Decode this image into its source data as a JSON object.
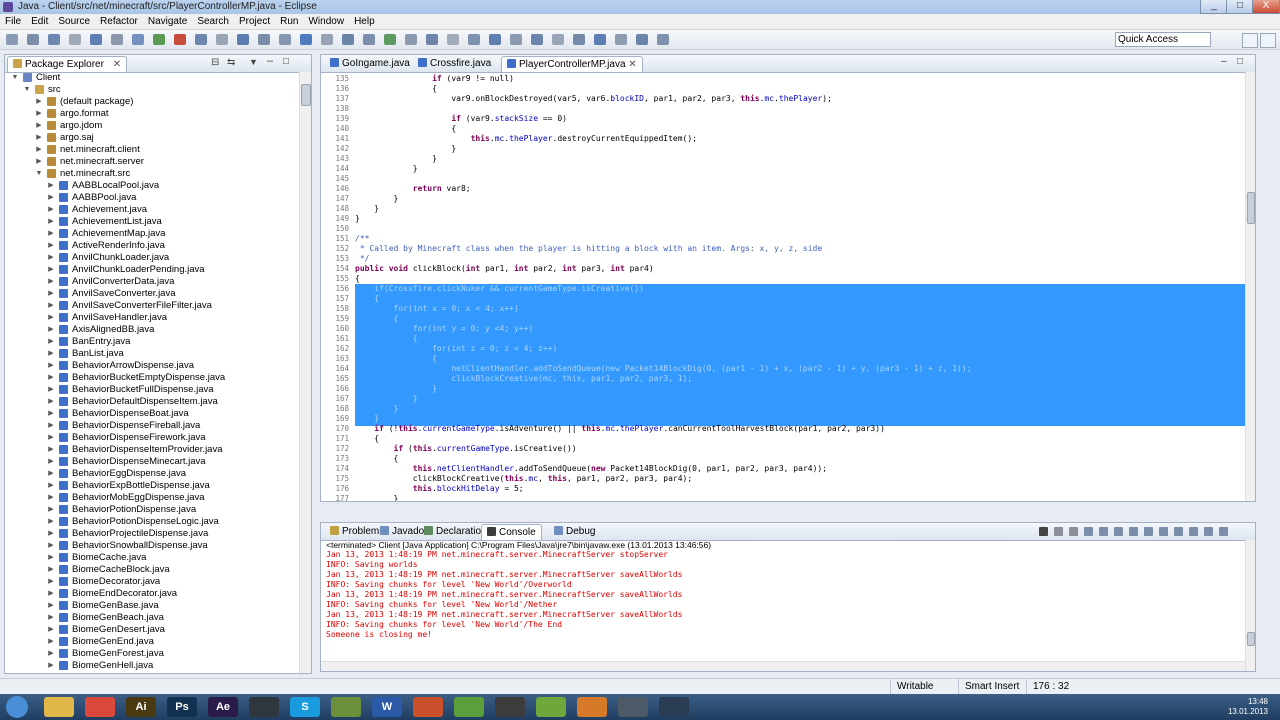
{
  "window": {
    "title": "Java - Client/src/net/minecraft/src/PlayerControllerMP.java - Eclipse",
    "min": "_",
    "max": "□",
    "close": "X"
  },
  "menu": [
    "File",
    "Edit",
    "Source",
    "Refactor",
    "Navigate",
    "Search",
    "Project",
    "Run",
    "Window",
    "Help"
  ],
  "toolbar": {
    "quick_access": "Quick Access"
  },
  "package_explorer": {
    "title": "Package Explorer",
    "items": [
      {
        "label": "Client",
        "depth": 0,
        "arrow": "▼",
        "icon": "#6a84c6"
      },
      {
        "label": "src",
        "depth": 1,
        "arrow": "▼",
        "icon": "#c9a347"
      },
      {
        "label": "(default package)",
        "depth": 2,
        "arrow": "▶",
        "icon": "#b88a3a"
      },
      {
        "label": "argo.format",
        "depth": 2,
        "arrow": "▶",
        "icon": "#b88a3a"
      },
      {
        "label": "argo.jdom",
        "depth": 2,
        "arrow": "▶",
        "icon": "#b88a3a"
      },
      {
        "label": "argo.saj",
        "depth": 2,
        "arrow": "▶",
        "icon": "#b88a3a"
      },
      {
        "label": "net.minecraft.client",
        "depth": 2,
        "arrow": "▶",
        "icon": "#b88a3a"
      },
      {
        "label": "net.minecraft.server",
        "depth": 2,
        "arrow": "▶",
        "icon": "#b88a3a"
      },
      {
        "label": "net.minecraft.src",
        "depth": 2,
        "arrow": "▼",
        "icon": "#b88a3a"
      },
      {
        "label": "AABBLocalPool.java",
        "depth": 3,
        "arrow": "▶",
        "icon": "#3f6fc9"
      },
      {
        "label": "AABBPool.java",
        "depth": 3,
        "arrow": "▶",
        "icon": "#3f6fc9"
      },
      {
        "label": "Achievement.java",
        "depth": 3,
        "arrow": "▶",
        "icon": "#3f6fc9"
      },
      {
        "label": "AchievementList.java",
        "depth": 3,
        "arrow": "▶",
        "icon": "#3f6fc9"
      },
      {
        "label": "AchievementMap.java",
        "depth": 3,
        "arrow": "▶",
        "icon": "#3f6fc9"
      },
      {
        "label": "ActiveRenderInfo.java",
        "depth": 3,
        "arrow": "▶",
        "icon": "#3f6fc9"
      },
      {
        "label": "AnvilChunkLoader.java",
        "depth": 3,
        "arrow": "▶",
        "icon": "#3f6fc9"
      },
      {
        "label": "AnvilChunkLoaderPending.java",
        "depth": 3,
        "arrow": "▶",
        "icon": "#3f6fc9"
      },
      {
        "label": "AnvilConverterData.java",
        "depth": 3,
        "arrow": "▶",
        "icon": "#3f6fc9"
      },
      {
        "label": "AnvilSaveConverter.java",
        "depth": 3,
        "arrow": "▶",
        "icon": "#3f6fc9"
      },
      {
        "label": "AnvilSaveConverterFileFilter.java",
        "depth": 3,
        "arrow": "▶",
        "icon": "#3f6fc9"
      },
      {
        "label": "AnvilSaveHandler.java",
        "depth": 3,
        "arrow": "▶",
        "icon": "#3f6fc9"
      },
      {
        "label": "AxisAlignedBB.java",
        "depth": 3,
        "arrow": "▶",
        "icon": "#3f6fc9"
      },
      {
        "label": "BanEntry.java",
        "depth": 3,
        "arrow": "▶",
        "icon": "#3f6fc9"
      },
      {
        "label": "BanList.java",
        "depth": 3,
        "arrow": "▶",
        "icon": "#3f6fc9"
      },
      {
        "label": "BehaviorArrowDispense.java",
        "depth": 3,
        "arrow": "▶",
        "icon": "#3f6fc9"
      },
      {
        "label": "BehaviorBucketEmptyDispense.java",
        "depth": 3,
        "arrow": "▶",
        "icon": "#3f6fc9"
      },
      {
        "label": "BehaviorBucketFullDispense.java",
        "depth": 3,
        "arrow": "▶",
        "icon": "#3f6fc9"
      },
      {
        "label": "BehaviorDefaultDispenseItem.java",
        "depth": 3,
        "arrow": "▶",
        "icon": "#3f6fc9"
      },
      {
        "label": "BehaviorDispenseBoat.java",
        "depth": 3,
        "arrow": "▶",
        "icon": "#3f6fc9"
      },
      {
        "label": "BehaviorDispenseFireball.java",
        "depth": 3,
        "arrow": "▶",
        "icon": "#3f6fc9"
      },
      {
        "label": "BehaviorDispenseFirework.java",
        "depth": 3,
        "arrow": "▶",
        "icon": "#3f6fc9"
      },
      {
        "label": "BehaviorDispenseItemProvider.java",
        "depth": 3,
        "arrow": "▶",
        "icon": "#3f6fc9"
      },
      {
        "label": "BehaviorDispenseMinecart.java",
        "depth": 3,
        "arrow": "▶",
        "icon": "#3f6fc9"
      },
      {
        "label": "BehaviorEggDispense.java",
        "depth": 3,
        "arrow": "▶",
        "icon": "#3f6fc9"
      },
      {
        "label": "BehaviorExpBottleDispense.java",
        "depth": 3,
        "arrow": "▶",
        "icon": "#3f6fc9"
      },
      {
        "label": "BehaviorMobEggDispense.java",
        "depth": 3,
        "arrow": "▶",
        "icon": "#3f6fc9"
      },
      {
        "label": "BehaviorPotionDispense.java",
        "depth": 3,
        "arrow": "▶",
        "icon": "#3f6fc9"
      },
      {
        "label": "BehaviorPotionDispenseLogic.java",
        "depth": 3,
        "arrow": "▶",
        "icon": "#3f6fc9"
      },
      {
        "label": "BehaviorProjectileDispense.java",
        "depth": 3,
        "arrow": "▶",
        "icon": "#3f6fc9"
      },
      {
        "label": "BehaviorSnowballDispense.java",
        "depth": 3,
        "arrow": "▶",
        "icon": "#3f6fc9"
      },
      {
        "label": "BiomeCache.java",
        "depth": 3,
        "arrow": "▶",
        "icon": "#3f6fc9"
      },
      {
        "label": "BiomeCacheBlock.java",
        "depth": 3,
        "arrow": "▶",
        "icon": "#3f6fc9"
      },
      {
        "label": "BiomeDecorator.java",
        "depth": 3,
        "arrow": "▶",
        "icon": "#3f6fc9"
      },
      {
        "label": "BiomeEndDecorator.java",
        "depth": 3,
        "arrow": "▶",
        "icon": "#3f6fc9"
      },
      {
        "label": "BiomeGenBase.java",
        "depth": 3,
        "arrow": "▶",
        "icon": "#3f6fc9"
      },
      {
        "label": "BiomeGenBeach.java",
        "depth": 3,
        "arrow": "▶",
        "icon": "#3f6fc9"
      },
      {
        "label": "BiomeGenDesert.java",
        "depth": 3,
        "arrow": "▶",
        "icon": "#3f6fc9"
      },
      {
        "label": "BiomeGenEnd.java",
        "depth": 3,
        "arrow": "▶",
        "icon": "#3f6fc9"
      },
      {
        "label": "BiomeGenForest.java",
        "depth": 3,
        "arrow": "▶",
        "icon": "#3f6fc9"
      },
      {
        "label": "BiomeGenHell.java",
        "depth": 3,
        "arrow": "▶",
        "icon": "#3f6fc9"
      }
    ]
  },
  "editor": {
    "tabs": [
      {
        "label": "GoIngame.java",
        "active": false
      },
      {
        "label": "Crossfire.java",
        "active": false
      },
      {
        "label": "PlayerControllerMP.java",
        "active": true
      }
    ],
    "lines": [
      {
        "n": "135",
        "t": "                if (var9 != null)",
        "sel": false
      },
      {
        "n": "136",
        "t": "                {",
        "sel": false
      },
      {
        "n": "137",
        "t": "                    var9.onBlockDestroyed(var5, var6.blockID, par1, par2, par3, this.mc.thePlayer);",
        "sel": false
      },
      {
        "n": "138",
        "t": "",
        "sel": false
      },
      {
        "n": "139",
        "t": "                    if (var9.stackSize == 0)",
        "sel": false
      },
      {
        "n": "140",
        "t": "                    {",
        "sel": false
      },
      {
        "n": "141",
        "t": "                        this.mc.thePlayer.destroyCurrentEquippedItem();",
        "sel": false
      },
      {
        "n": "142",
        "t": "                    }",
        "sel": false
      },
      {
        "n": "143",
        "t": "                }",
        "sel": false
      },
      {
        "n": "144",
        "t": "            }",
        "sel": false
      },
      {
        "n": "145",
        "t": "",
        "sel": false
      },
      {
        "n": "146",
        "t": "            return var8;",
        "sel": false
      },
      {
        "n": "147",
        "t": "        }",
        "sel": false
      },
      {
        "n": "148",
        "t": "    }",
        "sel": false
      },
      {
        "n": "149",
        "t": "}",
        "sel": false
      },
      {
        "n": "150",
        "t": "",
        "sel": false
      },
      {
        "n": "151",
        "t": "/**",
        "sel": false
      },
      {
        "n": "152",
        "t": " * Called by Minecraft class when the player is hitting a block with an item. Args: x, y, z, side",
        "sel": false
      },
      {
        "n": "153",
        "t": " */",
        "sel": false
      },
      {
        "n": "154",
        "t": "public void clickBlock(int par1, int par2, int par3, int par4)",
        "sel": false
      },
      {
        "n": "155",
        "t": "{",
        "sel": false
      },
      {
        "n": "156",
        "t": "    if(Crossfire.clickNuker && currentGameType.isCreative())",
        "sel": true
      },
      {
        "n": "157",
        "t": "    {",
        "sel": true
      },
      {
        "n": "158",
        "t": "        for(int x = 0; x < 4; x++)",
        "sel": true
      },
      {
        "n": "159",
        "t": "        {",
        "sel": true
      },
      {
        "n": "160",
        "t": "            for(int y = 0; y <4; y++)",
        "sel": true
      },
      {
        "n": "161",
        "t": "            {",
        "sel": true
      },
      {
        "n": "162",
        "t": "                for(int z = 0; z < 4; z++)",
        "sel": true
      },
      {
        "n": "163",
        "t": "                {",
        "sel": true
      },
      {
        "n": "164",
        "t": "                    netClientHandler.addToSendQueue(new Packet14BlockDig(0, (par1 - 1) + x, (par2 - 1) + y, (par3 - 1) + z, 1));",
        "sel": true
      },
      {
        "n": "165",
        "t": "                    clickBlockCreative(mc, this, par1, par2, par3, 1);",
        "sel": true
      },
      {
        "n": "166",
        "t": "                }",
        "sel": true
      },
      {
        "n": "167",
        "t": "            }",
        "sel": true
      },
      {
        "n": "168",
        "t": "        }",
        "sel": true
      },
      {
        "n": "169",
        "t": "    }",
        "sel": true
      },
      {
        "n": "170",
        "t": "    if (!this.currentGameType.isAdventure() || this.mc.thePlayer.canCurrentToolHarvestBlock(par1, par2, par3))",
        "sel": false
      },
      {
        "n": "171",
        "t": "    {",
        "sel": false
      },
      {
        "n": "172",
        "t": "        if (this.currentGameType.isCreative())",
        "sel": false
      },
      {
        "n": "173",
        "t": "        {",
        "sel": false
      },
      {
        "n": "174",
        "t": "            this.netClientHandler.addToSendQueue(new Packet14BlockDig(0, par1, par2, par3, par4));",
        "sel": false
      },
      {
        "n": "175",
        "t": "            clickBlockCreative(this.mc, this, par1, par2, par3, par4);",
        "sel": false
      },
      {
        "n": "176",
        "t": "            this.blockHitDelay = 5;",
        "sel": false
      },
      {
        "n": "177",
        "t": "        }",
        "sel": false
      }
    ]
  },
  "console": {
    "tabs": [
      {
        "label": "Problems",
        "active": false
      },
      {
        "label": "Javadoc",
        "active": false
      },
      {
        "label": "Declaration",
        "active": false
      },
      {
        "label": "Console",
        "active": true
      },
      {
        "label": "Debug",
        "active": false
      }
    ],
    "header": "<terminated> Client [Java Application] C:\\Program Files\\Java\\jre7\\bin\\javaw.exe (13.01.2013 13:46:56)",
    "lines": [
      "Jan 13, 2013 1:48:19 PM net.minecraft.server.MinecraftServer stopServer",
      "INFO: Saving worlds",
      "Jan 13, 2013 1:48:19 PM net.minecraft.server.MinecraftServer saveAllWorlds",
      "INFO: Saving chunks for level 'New World'/Overworld",
      "Jan 13, 2013 1:48:19 PM net.minecraft.server.MinecraftServer saveAllWorlds",
      "INFO: Saving chunks for level 'New World'/Nether",
      "Jan 13, 2013 1:48:19 PM net.minecraft.server.MinecraftServer saveAllWorlds",
      "INFO: Saving chunks for level 'New World'/The End",
      "Someone is closing me!"
    ]
  },
  "status": {
    "writable": "Writable",
    "insert": "Smart Insert",
    "position": "176 : 32"
  },
  "taskbar": {
    "apps": [
      {
        "name": "start-orb",
        "label": "",
        "color": "#4a8fd6"
      },
      {
        "name": "explorer",
        "label": "",
        "color": "#e0b84a"
      },
      {
        "name": "chrome",
        "label": "",
        "color": "#d9483b"
      },
      {
        "name": "illustrator",
        "label": "Ai",
        "color": "#4a3a12"
      },
      {
        "name": "photoshop",
        "label": "Ps",
        "color": "#12304f"
      },
      {
        "name": "after-effects",
        "label": "Ae",
        "color": "#2a1b4a"
      },
      {
        "name": "app-dark",
        "label": "",
        "color": "#30363e"
      },
      {
        "name": "skype",
        "label": "S",
        "color": "#1a9be0"
      },
      {
        "name": "minecraft",
        "label": "",
        "color": "#6b8f3a"
      },
      {
        "name": "word",
        "label": "W",
        "color": "#2b5aa8"
      },
      {
        "name": "powerpoint",
        "label": "",
        "color": "#c9502a"
      },
      {
        "name": "green-app",
        "label": "",
        "color": "#5b9e3c"
      },
      {
        "name": "dark-app",
        "label": "",
        "color": "#3c3c3c"
      },
      {
        "name": "spotify",
        "label": "",
        "color": "#6ea83c"
      },
      {
        "name": "avast",
        "label": "",
        "color": "#d67a2a"
      },
      {
        "name": "app-gray",
        "label": "",
        "color": "#4c5966"
      },
      {
        "name": "steam",
        "label": "",
        "color": "#2a3d55"
      }
    ],
    "time": "13:48",
    "date": "13.01.2013"
  }
}
